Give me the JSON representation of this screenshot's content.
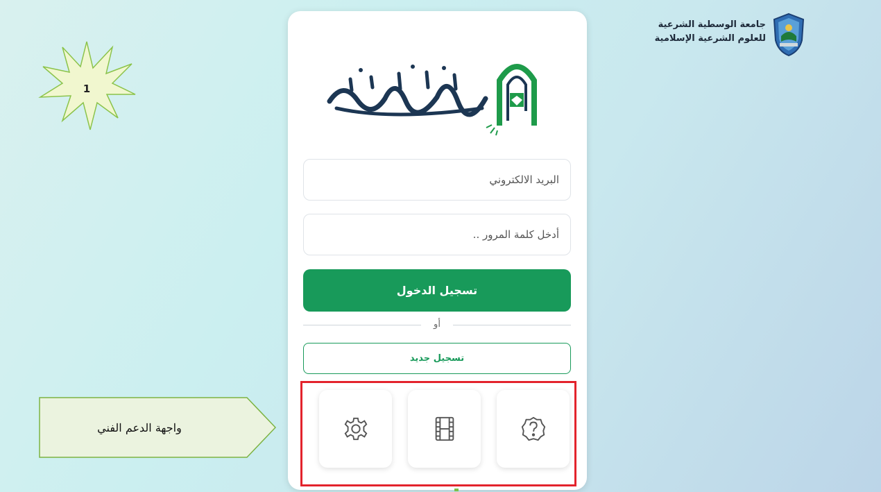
{
  "university": {
    "name_line1": "جامعة الوسطية الشرعية",
    "name_line2": "للعلوم الشرعية الإسلامية",
    "emblem": "shield-emblem-icon"
  },
  "badge": {
    "number": "1"
  },
  "login": {
    "email_placeholder": "البريد الالكتروني",
    "password_placeholder": "أدخل كلمة المرور ..",
    "login_label": "تسجيل الدخول",
    "or_label": "أو",
    "register_label": "تسجيل جديد"
  },
  "tiles": [
    {
      "icon": "gear-icon"
    },
    {
      "icon": "film-icon"
    },
    {
      "icon": "help-icon"
    }
  ],
  "callout": {
    "text": "واجهة الدعم الفني"
  },
  "colors": {
    "primary": "#189a5a",
    "highlight": "#e3232c",
    "callout_fill": "#ebf3df",
    "callout_stroke": "#7cb342"
  }
}
